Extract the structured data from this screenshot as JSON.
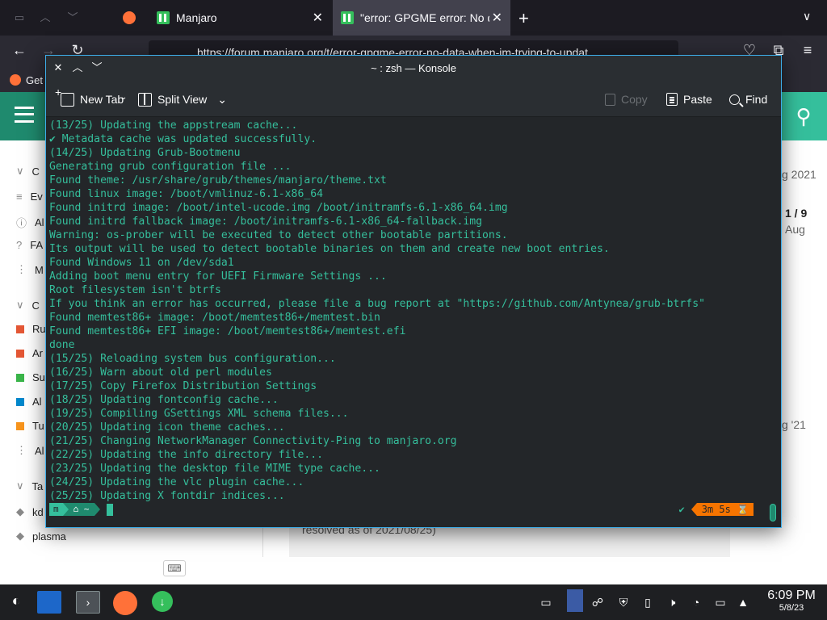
{
  "browser": {
    "tabs": [
      {
        "title": "Manjaro"
      },
      {
        "title": "\"error: GPGME error: No d"
      }
    ],
    "url": "https://forum.manjaro.org/t/error-gpgme-error-no-data-when-im-trying-to-updat",
    "bookmark_label": "Get"
  },
  "forum": {
    "sidebar_initials": [
      "C",
      "Ev",
      "Al",
      "FA",
      "M",
      "C",
      "Ru",
      "Ar",
      "Su",
      "Al",
      "Tu",
      "Al",
      "Ta",
      "kd",
      "plasma"
    ],
    "meta": {
      "date_top": "g 2021",
      "progress": "1 / 9",
      "month": "Aug",
      "date_bottom": "g '21"
    },
    "post_snippet": "resolved as of 2021/08/25)"
  },
  "konsole": {
    "title": "~ : zsh — Konsole",
    "toolbar": {
      "new_tab": "New Tab",
      "split_view": "Split View",
      "copy": "Copy",
      "paste": "Paste",
      "find": "Find"
    },
    "lines": [
      "(13/25) Updating the appstream cache...",
      "✔ Metadata cache was updated successfully.",
      "(14/25) Updating Grub-Bootmenu",
      "Generating grub configuration file ...",
      "Found theme: /usr/share/grub/themes/manjaro/theme.txt",
      "Found linux image: /boot/vmlinuz-6.1-x86_64",
      "Found initrd image: /boot/intel-ucode.img /boot/initramfs-6.1-x86_64.img",
      "Found initrd fallback image: /boot/initramfs-6.1-x86_64-fallback.img",
      "Warning: os-prober will be executed to detect other bootable partitions.",
      "Its output will be used to detect bootable binaries on them and create new boot entries.",
      "Found Windows 11 on /dev/sda1",
      "Adding boot menu entry for UEFI Firmware Settings ...",
      "Root filesystem isn't btrfs",
      "If you think an error has occurred, please file a bug report at \"https://github.com/Antynea/grub-btrfs\"",
      "Found memtest86+ image: /boot/memtest86+/memtest.bin",
      "Found memtest86+ EFI image: /boot/memtest86+/memtest.efi",
      "done",
      "(15/25) Reloading system bus configuration...",
      "(16/25) Warn about old perl modules",
      "(17/25) Copy Firefox Distribution Settings",
      "(18/25) Updating fontconfig cache...",
      "(19/25) Compiling GSettings XML schema files...",
      "(20/25) Updating icon theme caches...",
      "(21/25) Changing NetworkManager Connectivity-Ping to manjaro.org",
      "(22/25) Updating the info directory file...",
      "(23/25) Updating the desktop file MIME type cache...",
      "(24/25) Updating the vlc plugin cache...",
      "(25/25) Updating X fontdir indices..."
    ],
    "prompt": {
      "segment_icon": "m",
      "segment_dir": "⌂ ~",
      "status_check": "✔",
      "elapsed": "3m 5s ⌛"
    }
  },
  "taskbar": {
    "time": "6:09 PM",
    "date": "5/8/23"
  },
  "colors": {
    "accent": "#35bf9c",
    "forum_header": "#1f8a6e",
    "terminal_bg": "#232629",
    "elapsed_bg": "#f67400"
  }
}
